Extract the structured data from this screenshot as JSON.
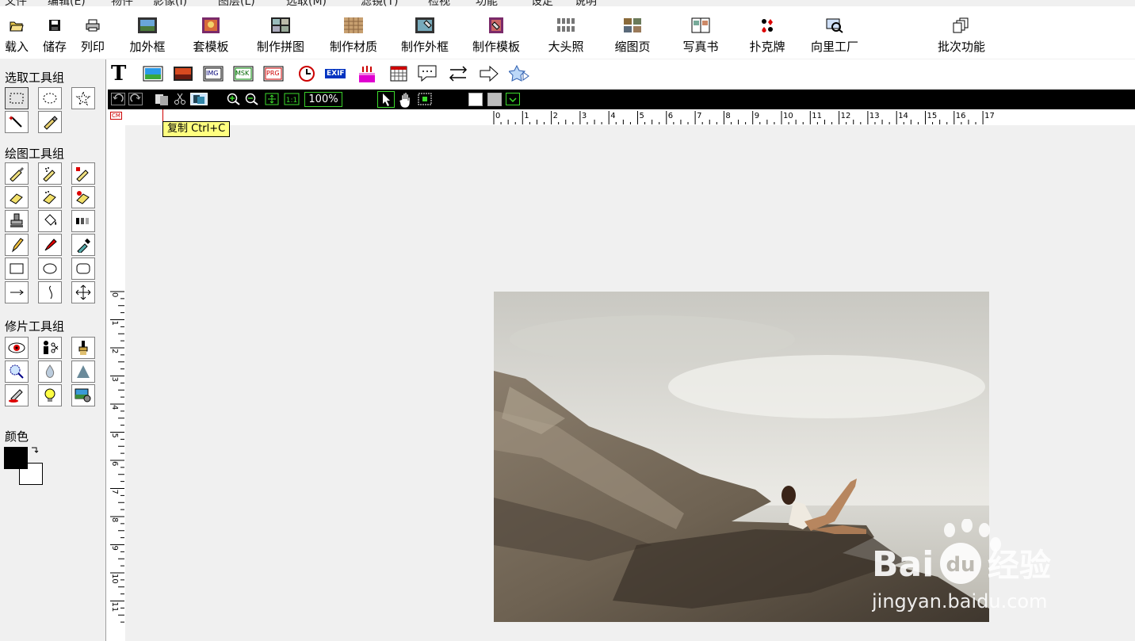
{
  "menubar": {
    "items": [
      "文件",
      "编辑(E)",
      "物件",
      "影像(I)",
      "图层(L)",
      "选取(M)",
      "滤镜(T)",
      "检视",
      "功能",
      "设定",
      "说明"
    ]
  },
  "toolbar": {
    "buttons": [
      {
        "key": "load",
        "label": "载入",
        "icon": "open-folder-icon"
      },
      {
        "key": "save",
        "label": "储存",
        "icon": "floppy-disk-icon"
      },
      {
        "key": "print",
        "label": "列印",
        "icon": "printer-icon"
      },
      {
        "key": "add_frame",
        "label": "加外框",
        "icon": "frame-icon"
      },
      {
        "key": "template",
        "label": "套模板",
        "icon": "template-icon"
      },
      {
        "key": "make_collage",
        "label": "制作拼图",
        "icon": "collage-icon"
      },
      {
        "key": "make_texture",
        "label": "制作材质",
        "icon": "texture-icon"
      },
      {
        "key": "make_frame",
        "label": "制作外框",
        "icon": "frame-editor-icon"
      },
      {
        "key": "make_template",
        "label": "制作模板",
        "icon": "template-editor-icon"
      },
      {
        "key": "id_photo",
        "label": "大头照",
        "icon": "id-photo-icon"
      },
      {
        "key": "thumbnail_page",
        "label": "缩图页",
        "icon": "thumbnail-icon"
      },
      {
        "key": "photo_book",
        "label": "写真书",
        "icon": "photo-book-icon"
      },
      {
        "key": "poker",
        "label": "扑克牌",
        "icon": "poker-cards-icon"
      },
      {
        "key": "wizard",
        "label": "向里工厂",
        "icon": "wizard-icon"
      },
      {
        "key": "batch",
        "label": "批次功能",
        "icon": "batch-icon"
      }
    ]
  },
  "palette": {
    "select_title": "选取工具组",
    "draw_title": "绘图工具组",
    "retouch_title": "修片工具组",
    "color_title": "颜色",
    "foreground_color": "#000000",
    "background_color": "#ffffff"
  },
  "objectbar": {
    "text_tool": "T",
    "img_label": "IMG",
    "msk_label": "MSK",
    "prg_label": "PRG",
    "exif_label": "EXIF"
  },
  "blackbar": {
    "zoom": "100%"
  },
  "ruler": {
    "unit": "CM",
    "top_ticks": [
      "0",
      "1",
      "2",
      "3",
      "4",
      "5",
      "6",
      "7",
      "8",
      "9",
      "10",
      "11",
      "12",
      "13",
      "14",
      "15",
      "16",
      "17"
    ],
    "left_ticks": [
      "0",
      "1",
      "2",
      "3",
      "4",
      "5",
      "6",
      "7",
      "8",
      "9",
      "10",
      "11"
    ]
  },
  "tooltip": {
    "text": "复制  Ctrl+C"
  },
  "watermark": {
    "brand_a": "Bai",
    "brand_b": "du",
    "brand_c": "经验",
    "url": "jingyan.baidu.com"
  }
}
